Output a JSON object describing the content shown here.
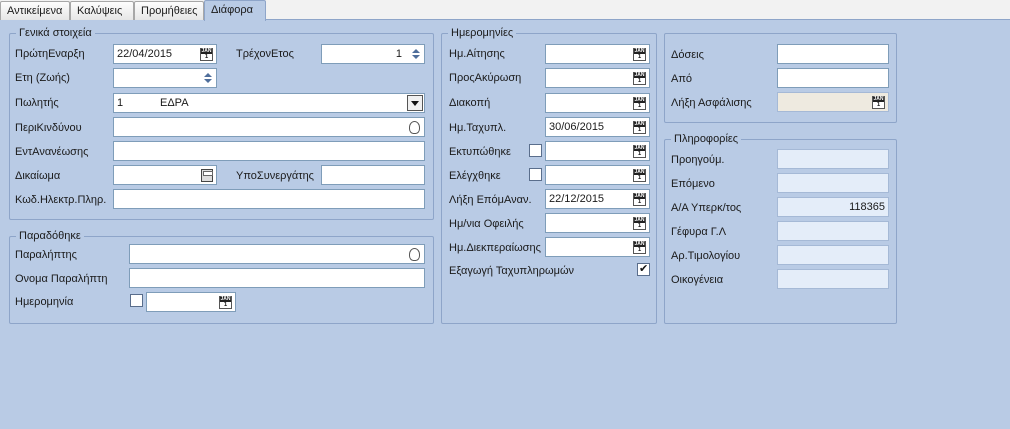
{
  "tabs": [
    {
      "label": "Αντικείμενα",
      "active": false
    },
    {
      "label": "Καλύψεις",
      "active": false
    },
    {
      "label": "Προμήθειες",
      "active": false
    },
    {
      "label": "Διάφορα",
      "active": true
    }
  ],
  "general": {
    "title": "Γενικά στοιχεία",
    "first_start_label": "ΠρώτηΕναρξη",
    "first_start_value": "22/04/2015",
    "current_year_label": "ΤρέχονΕτος",
    "current_year_value": "1",
    "life_years_label": "Ετη (Ζωής)",
    "life_years_value": "",
    "seller_label": "Πωλητής",
    "seller_code": "1",
    "seller_name": "ΕΔΡΑ",
    "risk_area_label": "ΠεριΚινδύνου",
    "risk_area_value": "",
    "renewal_label": "ΕντΑνανέωσης",
    "renewal_value": "",
    "right_label": "Δικαίωμα",
    "right_value": "",
    "subagent_label": "ΥποΣυνεργάτης",
    "subagent_value": "",
    "epay_code_label": "Κωδ.Ηλεκτρ.Πληρ.",
    "epay_code_value": ""
  },
  "delivered": {
    "title": "Παραδόθηκε",
    "receiver_label": "Παραλήπτης",
    "receiver_value": "",
    "receiver_name_label": "Ονομα Παραλήπτη",
    "receiver_name_value": "",
    "date_label": "Ημερομηνία",
    "date_checked": false,
    "date_value": ""
  },
  "dates": {
    "title": "Ημερομηνίες",
    "request_label": "Ημ.Αίτησης",
    "request_value": "",
    "pre_cancel_label": "ΠροςΑκύρωση",
    "pre_cancel_value": "",
    "stop_label": "Διακοπή",
    "stop_value": "",
    "postal_label": "Ημ.Ταχυπλ.",
    "postal_value": "30/06/2015",
    "printed_label": "Εκτυπώθηκε",
    "printed_checked": false,
    "printed_value": "",
    "checked_label": "Ελέγχθηκε",
    "checked_checked": false,
    "checked_value": "",
    "next_renewal_end_label": "Λήξη ΕπόμΑναν.",
    "next_renewal_end_value": "22/12/2015",
    "due_date_label": "Ημ/νια Οφειλής",
    "due_date_value": "",
    "settlement_label": "Ημ.Διεκπεραίωσης",
    "settlement_value": "",
    "export_label": "Εξαγωγή Ταχυπληρωμών",
    "export_checked": true
  },
  "installments": {
    "doses_label": "Δόσεις",
    "doses_value": "",
    "from_label": "Από",
    "from_value": "",
    "insurance_end_label": "Λήξη Ασφάλισης",
    "insurance_end_value": ""
  },
  "info": {
    "title": "Πληροφορίες",
    "previous_label": "Προηγούμ.",
    "previous_value": "",
    "next_label": "Επόμενο",
    "next_value": "",
    "aa_label": "Α/Α Υπερκ/τος",
    "aa_value": "118365",
    "bridge_label": "Γέφυρα Γ.Λ",
    "bridge_value": "",
    "invoice_label": "Αρ.Τιμολογίου",
    "invoice_value": "",
    "family_label": "Οικογένεια",
    "family_value": ""
  }
}
